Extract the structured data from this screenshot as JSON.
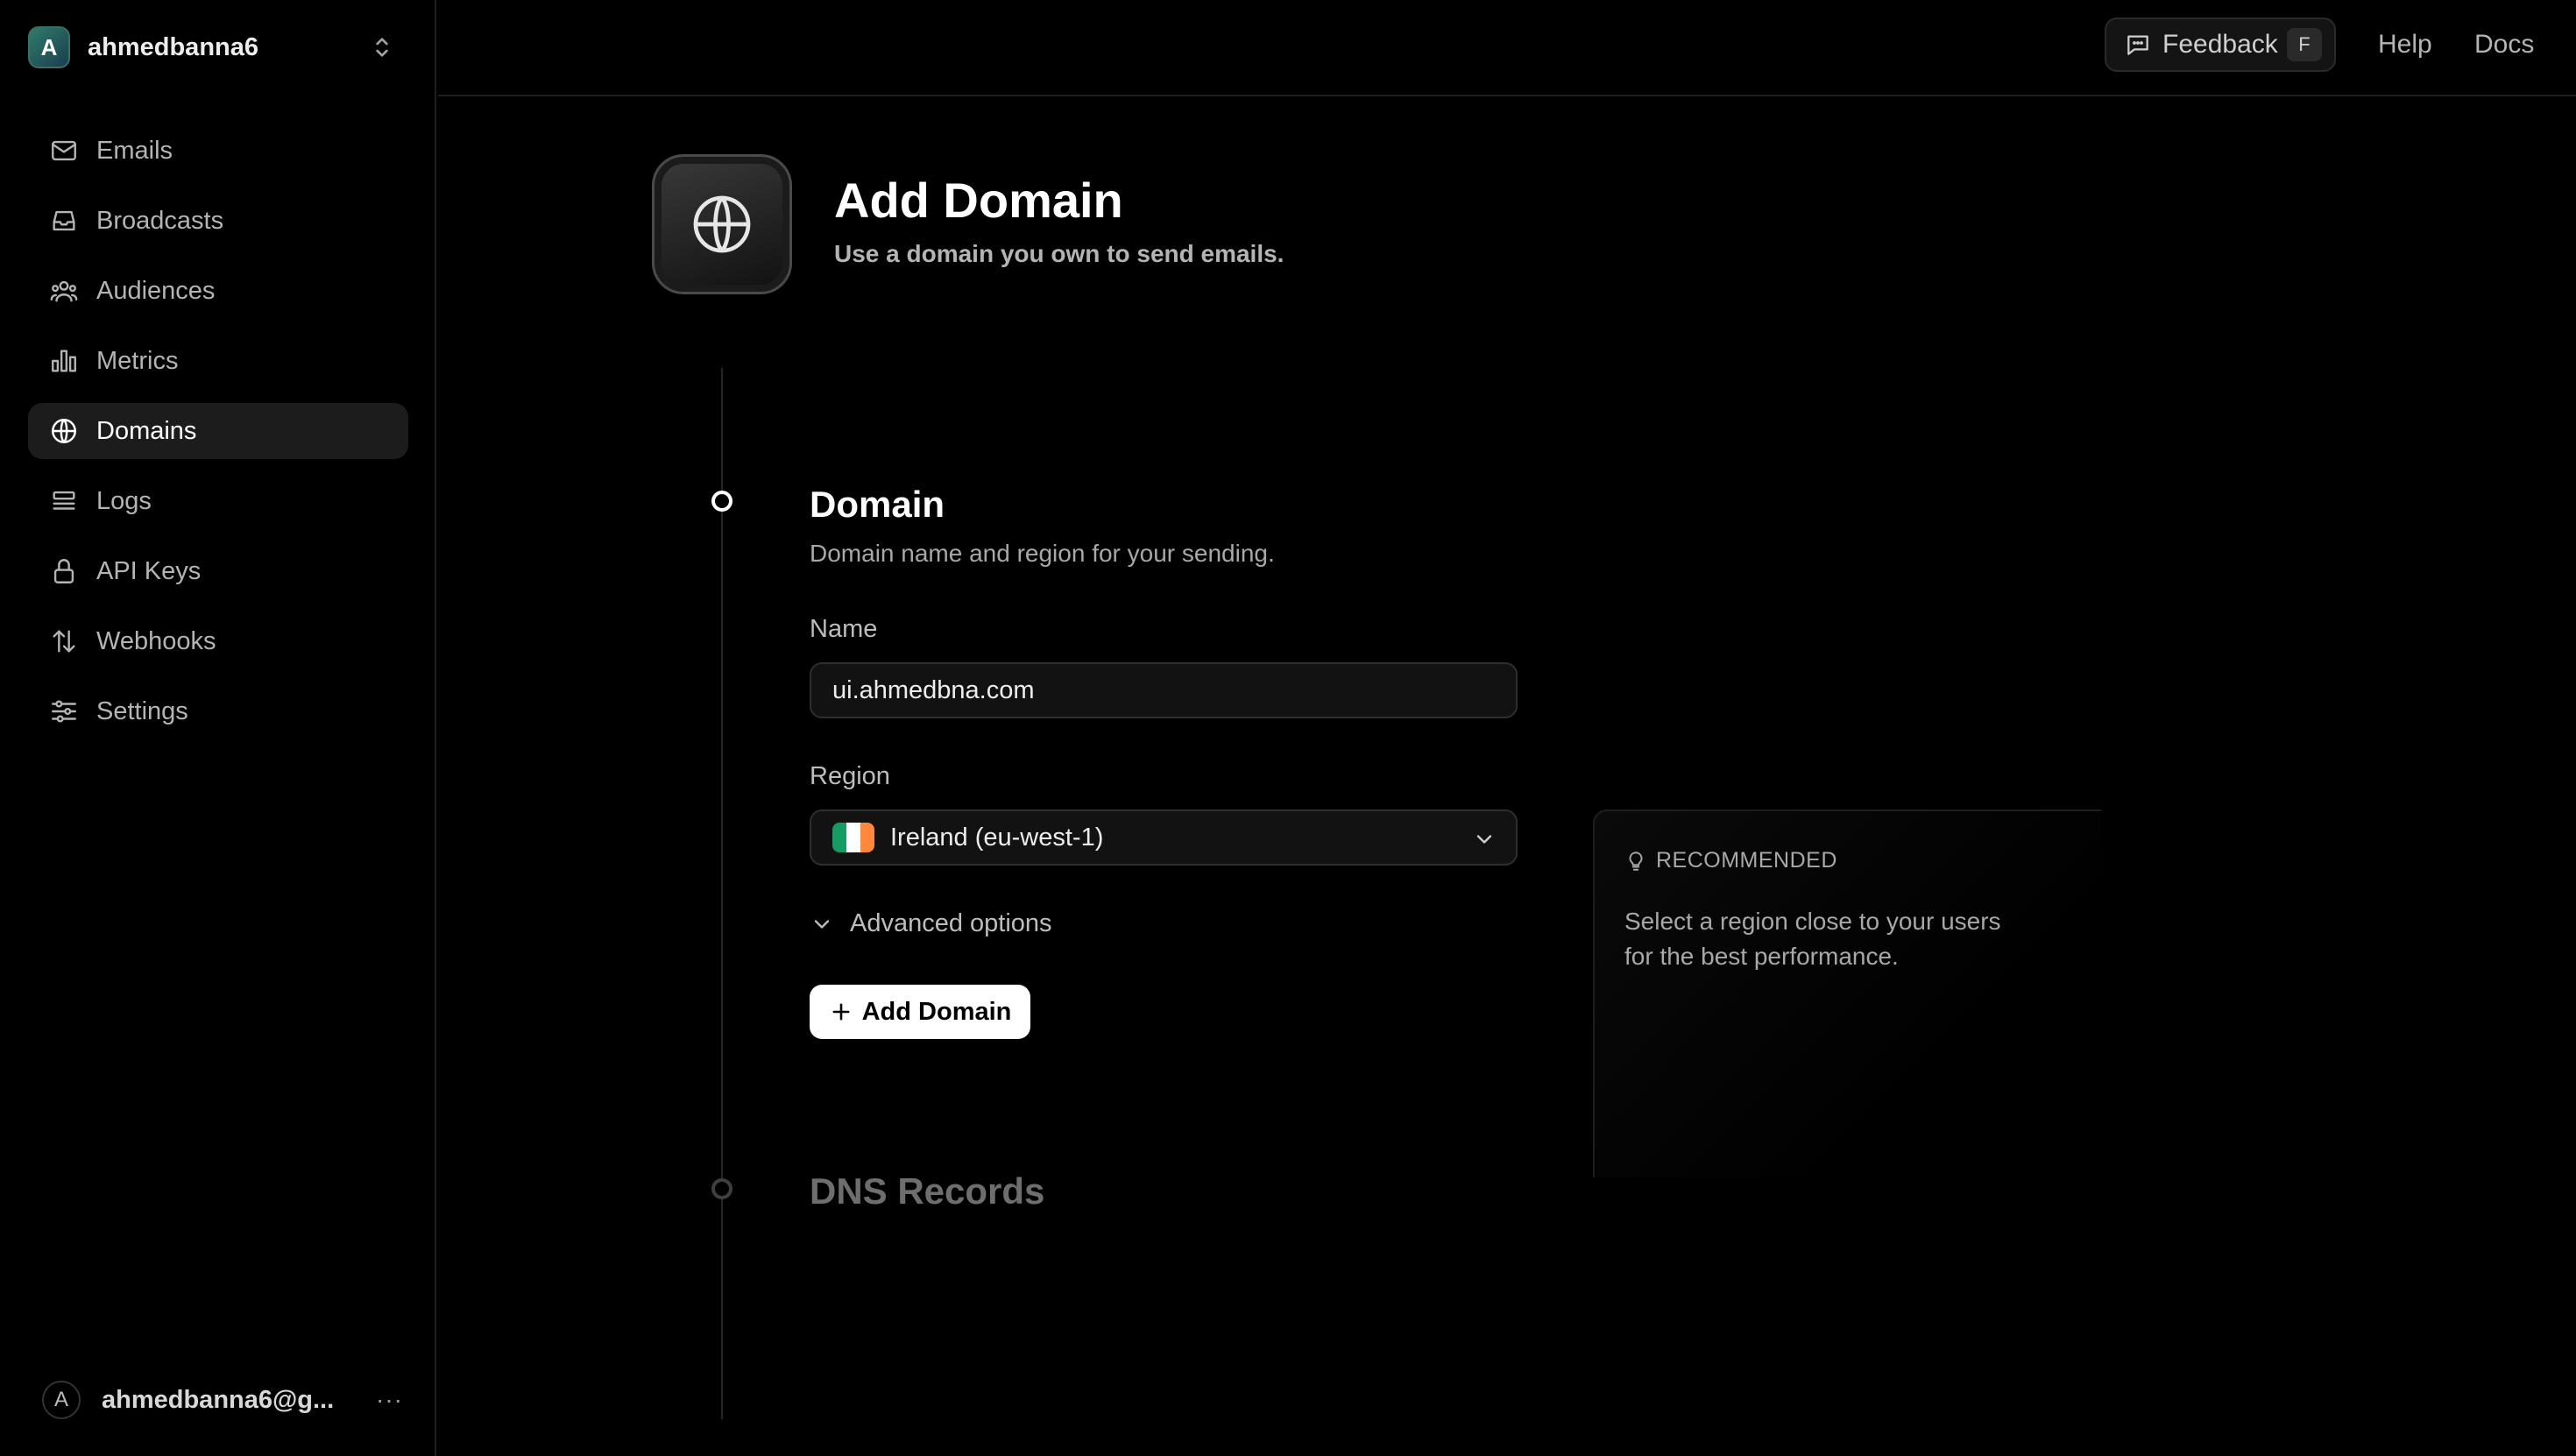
{
  "team": {
    "initial": "A",
    "name": "ahmedbanna6"
  },
  "nav": [
    {
      "label": "Emails",
      "icon": "mail-icon",
      "active": false
    },
    {
      "label": "Broadcasts",
      "icon": "inbox-icon",
      "active": false
    },
    {
      "label": "Audiences",
      "icon": "users-icon",
      "active": false
    },
    {
      "label": "Metrics",
      "icon": "bar-chart-icon",
      "active": false
    },
    {
      "label": "Domains",
      "icon": "globe-icon",
      "active": true
    },
    {
      "label": "Logs",
      "icon": "logs-icon",
      "active": false
    },
    {
      "label": "API Keys",
      "icon": "lock-icon",
      "active": false
    },
    {
      "label": "Webhooks",
      "icon": "arrows-icon",
      "active": false
    },
    {
      "label": "Settings",
      "icon": "sliders-icon",
      "active": false
    }
  ],
  "user": {
    "initial": "A",
    "email": "ahmedbanna6@g...",
    "more": "···"
  },
  "topbar": {
    "feedback": "Feedback",
    "feedback_key": "F",
    "help": "Help",
    "docs": "Docs"
  },
  "header": {
    "title": "Add Domain",
    "subtitle": "Use a domain you own to send emails."
  },
  "domain_section": {
    "title": "Domain",
    "description": "Domain name and region for your sending.",
    "name_label": "Name",
    "name_value": "ui.ahmedbna.com",
    "region_label": "Region",
    "region_value": "Ireland (eu-west-1)",
    "advanced": "Advanced options",
    "submit": "Add Domain"
  },
  "dns_section": {
    "title": "DNS Records"
  },
  "recommendation": {
    "heading": "RECOMMENDED",
    "body": "Select a region close to your users for the best performance."
  },
  "colors": {
    "accent": "#ffffff",
    "background": "#000000",
    "flag_green": "#169b62",
    "flag_white": "#ffffff",
    "flag_orange": "#ff883e"
  }
}
